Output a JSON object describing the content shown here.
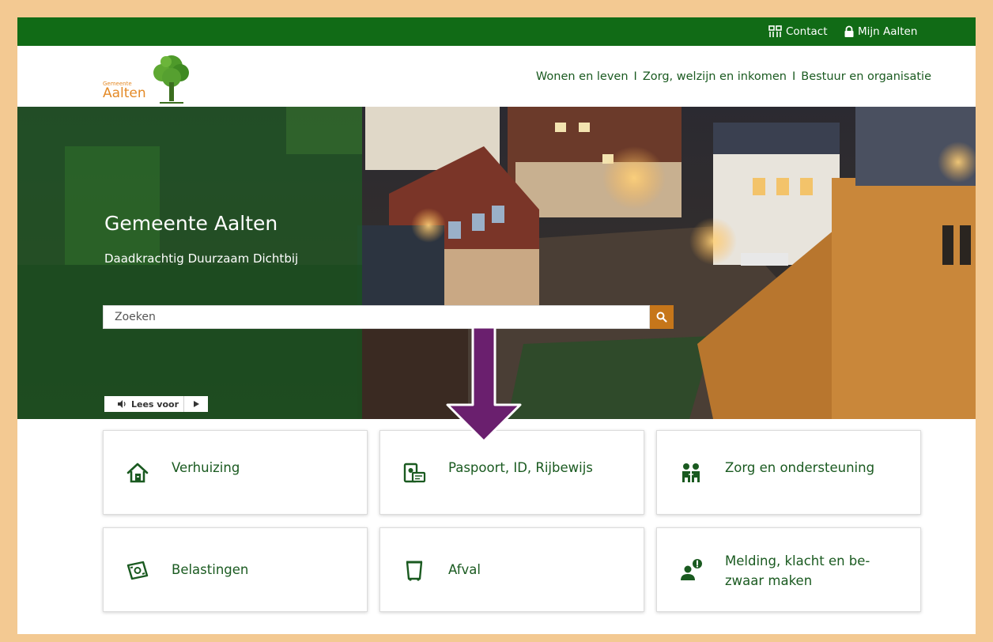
{
  "topbar": {
    "contact_label": "Contact",
    "mijn_label": "Mijn Aalten"
  },
  "logo": {
    "small_text": "Gemeente",
    "name": "Aalten"
  },
  "nav": {
    "items": [
      "Wonen en leven",
      "Zorg, welzijn en inkomen",
      "Bestuur en organisatie"
    ],
    "separator": "I"
  },
  "hero": {
    "title": "Gemeente Aalten",
    "subtitle": "Daadkrachtig Duurzaam Dichtbij"
  },
  "search": {
    "placeholder": "Zoeken"
  },
  "readspeaker": {
    "label": "Lees voor"
  },
  "tiles": [
    {
      "label": "Verhuizing",
      "icon": "house-icon"
    },
    {
      "label": "Paspoort, ID, Rijbewijs",
      "icon": "id-card-icon"
    },
    {
      "label": "Zorg en ondersteuning",
      "icon": "people-icon"
    },
    {
      "label": "Belastingen",
      "icon": "money-icon"
    },
    {
      "label": "Afval",
      "icon": "bin-icon"
    },
    {
      "label": "Melding, klacht en be-zwaar maken",
      "line1": "Melding, klacht en be-",
      "line2": "zwaar maken",
      "icon": "report-person-icon"
    }
  ],
  "colors": {
    "topbar_green": "#116b16",
    "text_green": "#1a5a20",
    "logo_orange": "#e48a27",
    "search_button": "#c6761a",
    "arrow_purple": "#6a1f6e",
    "page_border": "#f3c992"
  }
}
